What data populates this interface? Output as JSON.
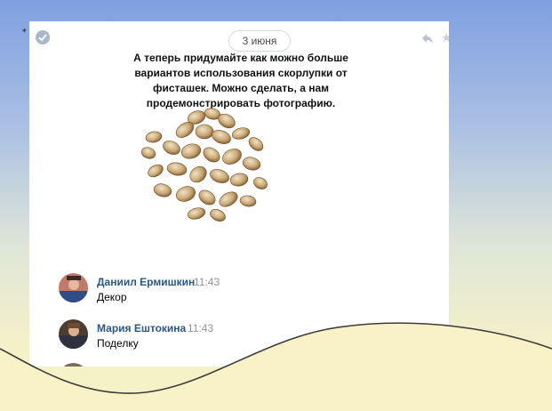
{
  "date_label": "3 июня",
  "message_text": "А теперь придумайте как можно больше вариантов использования скорлупки от фисташек. Можно сделать, а нам продемонстрировать фотографию.",
  "comments": [
    {
      "author": "Даниил Ермишкин",
      "time": "11:43",
      "text": "Декор"
    },
    {
      "author": "Мария Ештокина",
      "time": "11:43",
      "text": "Поделку"
    }
  ],
  "icons": {
    "check": "check-icon",
    "reply": "reply-icon",
    "star": "star-icon"
  },
  "colors": {
    "author": "#2a5885",
    "time": "#939393",
    "wave": "#3c3c3c"
  }
}
